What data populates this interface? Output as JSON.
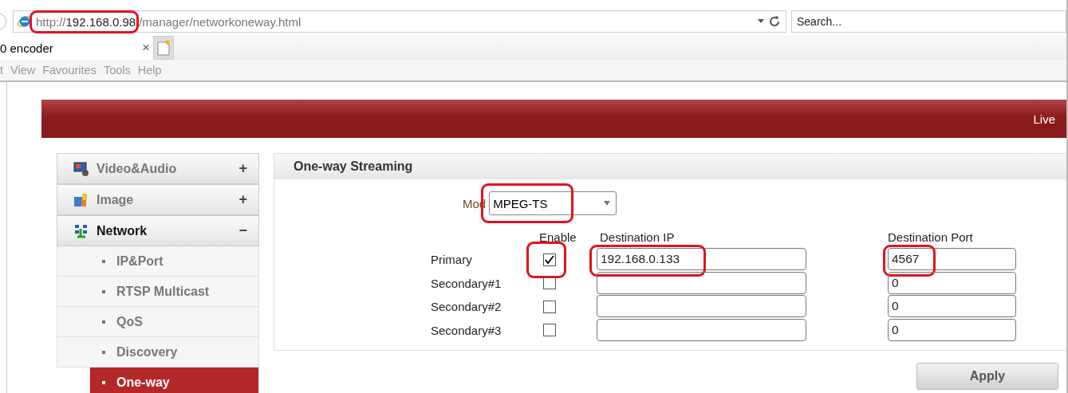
{
  "browser": {
    "address": {
      "scheme": "http://",
      "host": "192.168.0.98",
      "path": "/manager/networkoneway.html",
      "highlighted": true
    },
    "search": {
      "placeholder": "Search..."
    },
    "tab": {
      "title": "0 encoder",
      "close": "×"
    },
    "menu": [
      "t",
      "View",
      "Favourites",
      "Tools",
      "Help"
    ]
  },
  "header": {
    "link": "Live"
  },
  "sidebar": {
    "items": [
      {
        "label": "Video&Audio",
        "toggle": "+",
        "expanded": false
      },
      {
        "label": "Image",
        "toggle": "+",
        "expanded": false
      },
      {
        "label": "Network",
        "toggle": "−",
        "expanded": true,
        "children": [
          {
            "label": "IP&Port",
            "selected": false
          },
          {
            "label": "RTSP Multicast",
            "selected": false
          },
          {
            "label": "QoS",
            "selected": false
          },
          {
            "label": "Discovery",
            "selected": false
          },
          {
            "label": "One-way",
            "selected": true
          }
        ]
      }
    ]
  },
  "panel": {
    "title": "One-way Streaming",
    "mode": {
      "label": "Mod",
      "value": "MPEG-TS",
      "highlighted": true
    },
    "columns": {
      "enable": "Enable",
      "ip": "Destination IP",
      "port": "Destination Port"
    },
    "rows": [
      {
        "label": "Primary",
        "enabled": true,
        "ip": "192.168.0.133",
        "port": "4567",
        "highlighted": true
      },
      {
        "label": "Secondary#1",
        "enabled": false,
        "ip": "",
        "port": "0",
        "highlighted": false
      },
      {
        "label": "Secondary#2",
        "enabled": false,
        "ip": "",
        "port": "0",
        "highlighted": false
      },
      {
        "label": "Secondary#3",
        "enabled": false,
        "ip": "",
        "port": "0",
        "highlighted": false
      }
    ]
  },
  "apply": "Apply"
}
